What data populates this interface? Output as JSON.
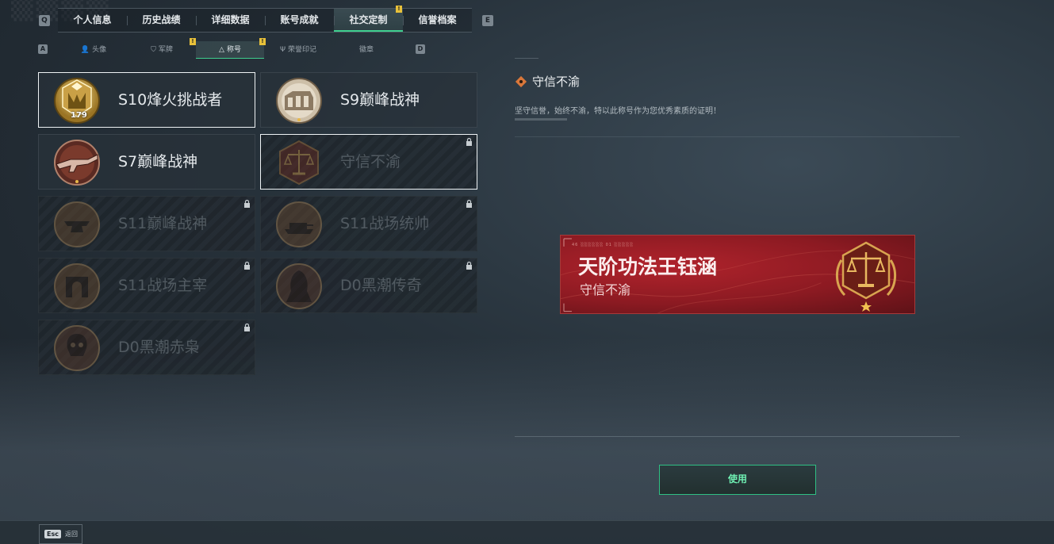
{
  "top_tabs": [
    {
      "label": "个人信息"
    },
    {
      "label": "历史战绩"
    },
    {
      "label": "详细数据"
    },
    {
      "label": "账号成就"
    },
    {
      "label": "社交定制",
      "active": true,
      "flag": "!"
    },
    {
      "label": "信誉档案"
    }
  ],
  "key_hints": {
    "top_left": "Q",
    "top_right": "E",
    "sub_left": "A",
    "sub_right": "D"
  },
  "sub_tabs": [
    {
      "label": "头像",
      "icon": "person-icon"
    },
    {
      "label": "军牌",
      "icon": "dogtag-icon",
      "flag": "!"
    },
    {
      "label": "称号",
      "icon": "title-icon",
      "active": true,
      "flag": "!"
    },
    {
      "label": "荣誉印记",
      "icon": "honor-mark-icon"
    },
    {
      "label": "徽章",
      "icon": "badge-icon"
    }
  ],
  "cards": [
    {
      "label": "S10烽火挑战者",
      "level": "179",
      "emblem": "gold-rank-emblem",
      "state": "owned",
      "selected": false
    },
    {
      "label": "S9巅峰战神",
      "emblem": "fortress-emblem",
      "state": "owned"
    },
    {
      "label": "S7巅峰战神",
      "emblem": "rifle-emblem",
      "state": "owned"
    },
    {
      "label": "守信不渝",
      "emblem": "scales-emblem",
      "state": "locked",
      "selected": true
    },
    {
      "label": "S11巅峰战神",
      "emblem": "anvil-emblem",
      "state": "locked"
    },
    {
      "label": "S11战场统帅",
      "emblem": "tank-emblem",
      "state": "locked"
    },
    {
      "label": "S11战场主宰",
      "emblem": "arch-emblem",
      "state": "locked"
    },
    {
      "label": "D0黑潮传奇",
      "emblem": "hooded-figure-emblem",
      "state": "locked"
    },
    {
      "label": "D0黑潮赤枭",
      "emblem": "skull-emblem",
      "state": "locked"
    }
  ],
  "detail": {
    "title": "守信不渝",
    "description": "坚守信誉，始终不渝，特以此称号作为您优秀素质的证明！"
  },
  "banner": {
    "code": "46 ░░░░░░ 01 ░░░░░",
    "player_name": "天阶功法王钰涵",
    "title": "守信不渝",
    "emblem": "scales-emblem"
  },
  "use_button": {
    "label": "使用"
  },
  "footer": {
    "key": "Esc",
    "label": "返回"
  },
  "colors": {
    "accent": "#3ecf8e",
    "banner_red": "#9e1f27",
    "flag_yellow": "#e8c13a"
  }
}
